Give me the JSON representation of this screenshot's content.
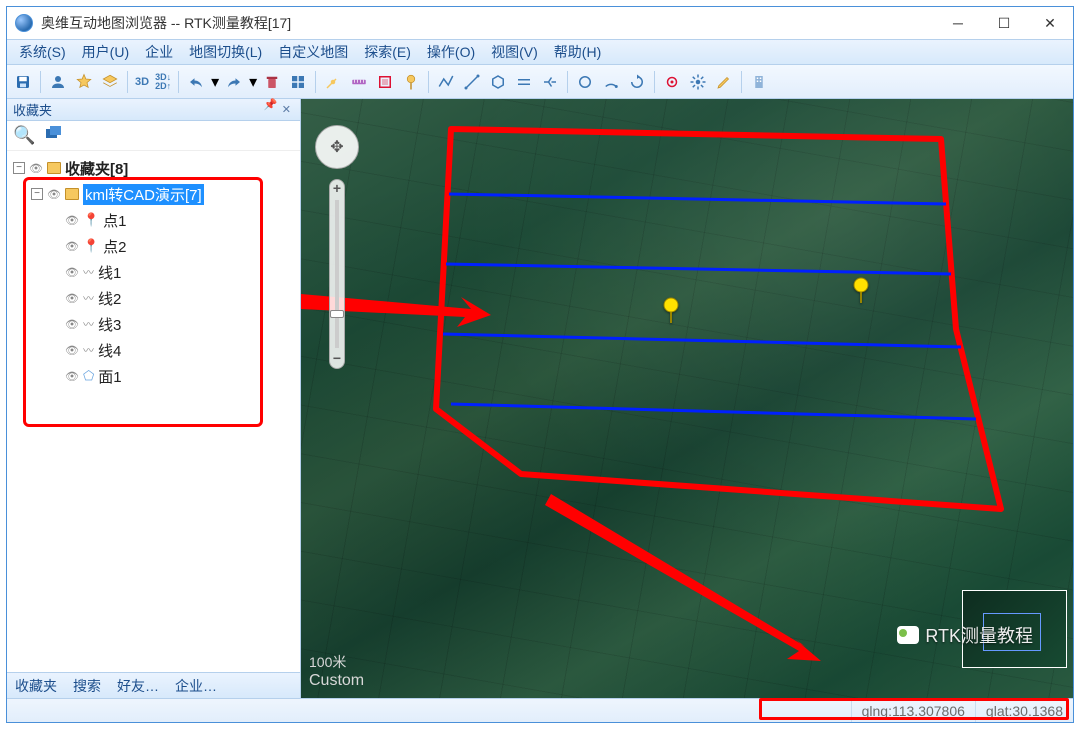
{
  "window": {
    "title": "奥维互动地图浏览器 -- RTK测量教程[17]"
  },
  "menu": {
    "items": [
      "系统(S)",
      "用户(U)",
      "企业",
      "地图切换(L)",
      "自定义地图",
      "探索(E)",
      "操作(O)",
      "视图(V)",
      "帮助(H)"
    ]
  },
  "toolbar": {
    "threeD": "3D",
    "threeD2D": "3D↓\n2D↑"
  },
  "side": {
    "panel_title": "收藏夹",
    "root_label": "收藏夹[8]",
    "selected": "kml转CAD演示[7]",
    "items": [
      "点1",
      "点2",
      "线1",
      "线2",
      "线3",
      "线4",
      "面1"
    ],
    "tabs": [
      "收藏夹",
      "搜索",
      "好友…",
      "企业…"
    ]
  },
  "map": {
    "scale": "100米",
    "provider": "Custom"
  },
  "watermark": {
    "text": "RTK测量教程"
  },
  "status": {
    "lng_label": "glng:113.307806",
    "lat_label": "glat:30.1368"
  }
}
